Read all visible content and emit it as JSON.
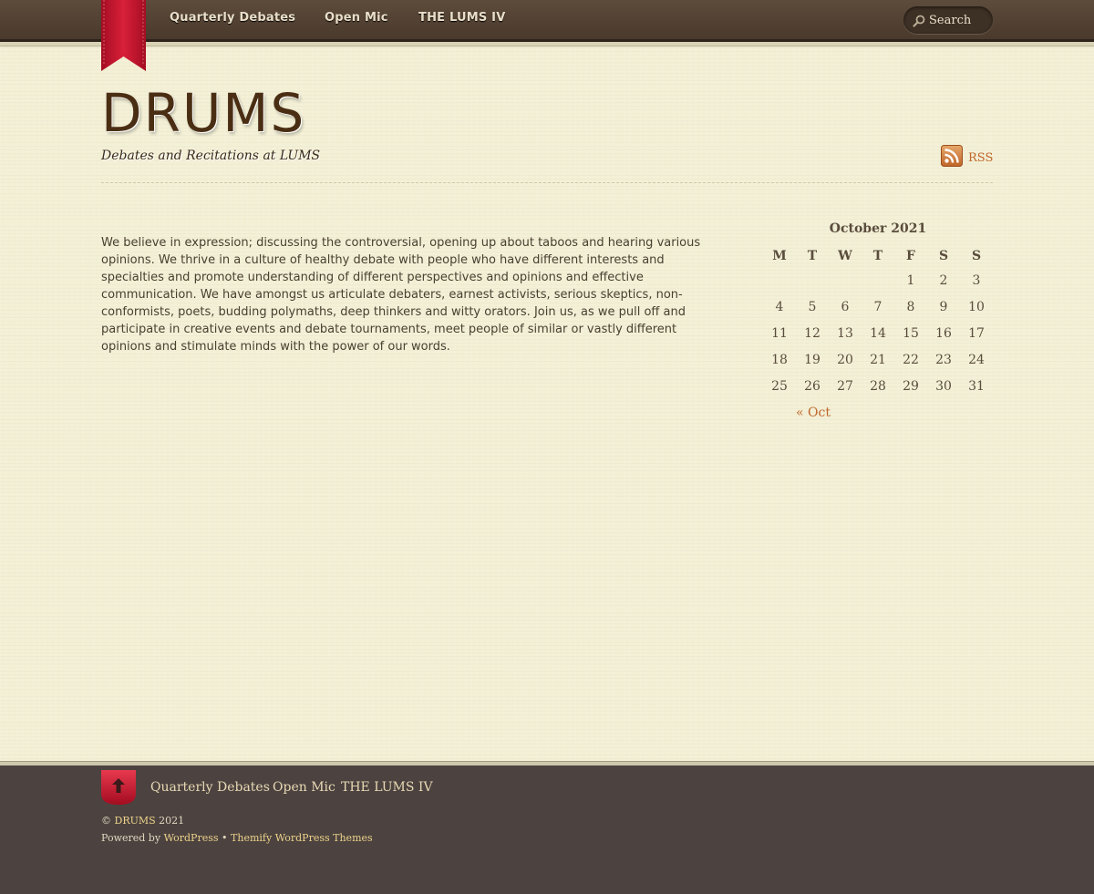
{
  "nav": {
    "items": [
      {
        "label": "Quarterly Debates"
      },
      {
        "label": "Open Mic"
      },
      {
        "label": "THE LUMS IV"
      }
    ],
    "search_placeholder": "Search"
  },
  "header": {
    "title": "DRUMS",
    "tagline": "Debates and Recitations at LUMS",
    "rss_label": "RSS"
  },
  "content": {
    "intro": "We believe in expression; discussing the controversial, opening up about taboos and hearing various opinions. We thrive in a culture of healthy debate with people who have different interests and specialties and promote understanding of different perspectives and opinions and effective communication. We have amongst us articulate debaters, earnest activists, serious skeptics, non-conformists, poets, budding polymaths, deep thinkers and witty orators. Join us, as we pull off and participate in creative events and debate tournaments, meet people of similar or vastly different opinions and stimulate minds with the power of our words."
  },
  "calendar": {
    "caption": "October 2021",
    "weekdays": [
      "M",
      "T",
      "W",
      "T",
      "F",
      "S",
      "S"
    ],
    "weeks": [
      [
        "",
        "",
        "",
        "",
        "1",
        "2",
        "3"
      ],
      [
        "4",
        "5",
        "6",
        "7",
        "8",
        "9",
        "10"
      ],
      [
        "11",
        "12",
        "13",
        "14",
        "15",
        "16",
        "17"
      ],
      [
        "18",
        "19",
        "20",
        "21",
        "22",
        "23",
        "24"
      ],
      [
        "25",
        "26",
        "27",
        "28",
        "29",
        "30",
        "31"
      ]
    ],
    "prev_label": "« Oct"
  },
  "footer": {
    "nav": [
      {
        "label": "Quarterly Debates"
      },
      {
        "label": "Open Mic"
      },
      {
        "label": "THE LUMS IV"
      }
    ],
    "copyright_symbol": "©",
    "site_name": "DRUMS",
    "year": "2021",
    "powered_prefix": "Powered by",
    "wordpress": "WordPress",
    "separator": "•",
    "themify": "Themify WordPress Themes"
  },
  "colors": {
    "nav_bg": "#4a3a2c",
    "accent": "#c0662a",
    "ribbon": "#c8102e",
    "footer_bg": "#4c4340"
  }
}
